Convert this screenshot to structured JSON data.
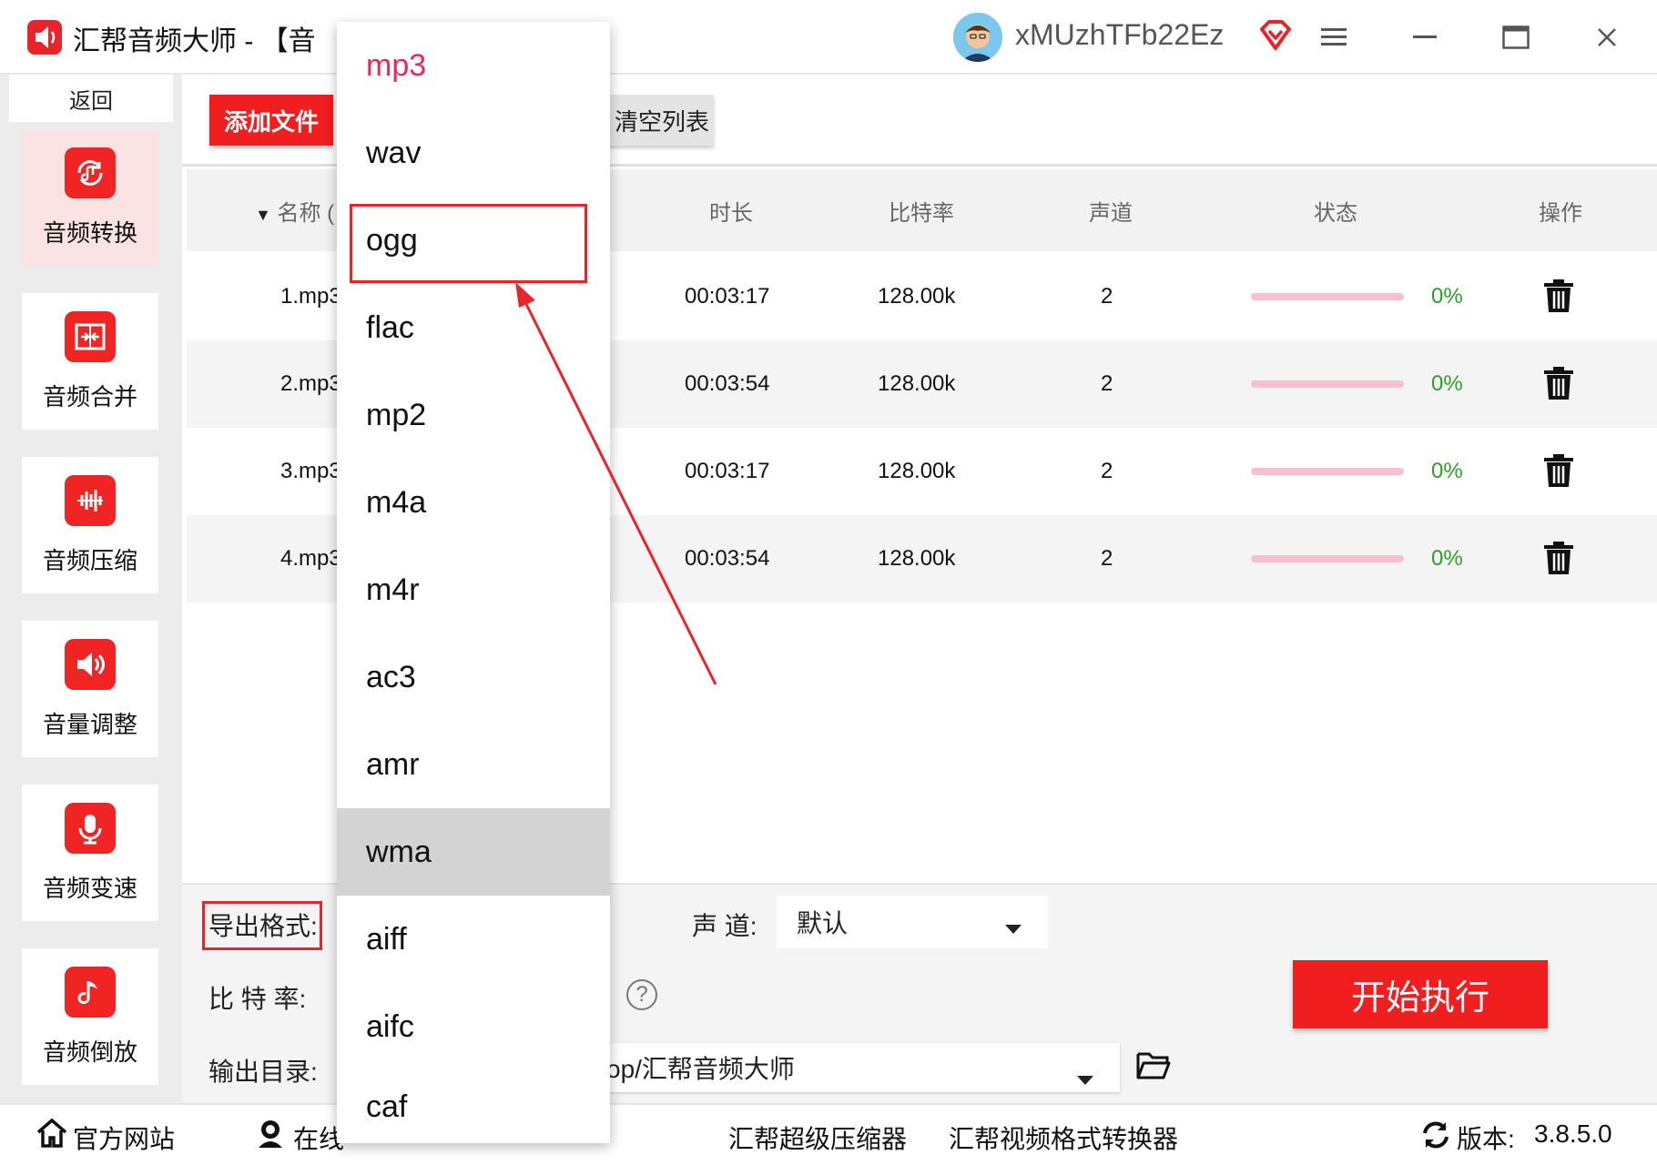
{
  "window": {
    "app_title": "汇帮音频大师  -  【音",
    "username": "xMUzhTFb22Ez"
  },
  "sidebar": {
    "back_label": "返回",
    "items": [
      {
        "label": "音频转换",
        "icon": "audio-convert-icon"
      },
      {
        "label": "音频合并",
        "icon": "audio-merge-icon"
      },
      {
        "label": "音频压缩",
        "icon": "audio-compress-icon"
      },
      {
        "label": "音量调整",
        "icon": "volume-adjust-icon"
      },
      {
        "label": "音频变速",
        "icon": "audio-speed-icon"
      },
      {
        "label": "音频倒放",
        "icon": "audio-reverse-icon"
      }
    ]
  },
  "toolbar": {
    "add_file_label": "添加文件",
    "clear_list_label": "清空列表"
  },
  "table": {
    "headers": {
      "name": "名称 (",
      "duration": "时长",
      "bitrate": "比特率",
      "channels": "声道",
      "status": "状态",
      "actions": "操作"
    },
    "rows": [
      {
        "name": "1.mp3",
        "duration": "00:03:17",
        "bitrate": "128.00k",
        "channels": "2",
        "progress_text": "0%",
        "progress": 0
      },
      {
        "name": "2.mp3",
        "duration": "00:03:54",
        "bitrate": "128.00k",
        "channels": "2",
        "progress_text": "0%",
        "progress": 0
      },
      {
        "name": "3.mp3",
        "duration": "00:03:17",
        "bitrate": "128.00k",
        "channels": "2",
        "progress_text": "0%",
        "progress": 0
      },
      {
        "name": "4.mp3",
        "duration": "00:03:54",
        "bitrate": "128.00k",
        "channels": "2",
        "progress_text": "0%",
        "progress": 0
      }
    ]
  },
  "settings": {
    "format_label": "导出格式:",
    "channel_label": "声 道:",
    "channel_value": "默认",
    "bitrate_label": "比 特 率:",
    "help_symbol": "?",
    "output_dir_label": "输出目录:",
    "output_dir_value": "op/汇帮音频大师",
    "start_label": "开始执行"
  },
  "format_dropdown": {
    "options": [
      "mp3",
      "wav",
      "ogg",
      "flac",
      "mp2",
      "m4a",
      "m4r",
      "ac3",
      "amr",
      "wma",
      "aiff",
      "aifc",
      "caf"
    ],
    "selected": "mp3",
    "hovered": "wma",
    "highlighted": "ogg"
  },
  "statusbar": {
    "website_label": "官方网站",
    "online_label": "在线",
    "compressor_label": "汇帮超级压缩器",
    "video_converter_label": "汇帮视频格式转换器",
    "version_label": "版本:",
    "version_value": "3.8.5.0"
  },
  "colors": {
    "accent": "#f01e1e",
    "selected_option": "#e8285c",
    "progress_track": "#f7bfd0",
    "percent_text": "#2aa02a"
  }
}
